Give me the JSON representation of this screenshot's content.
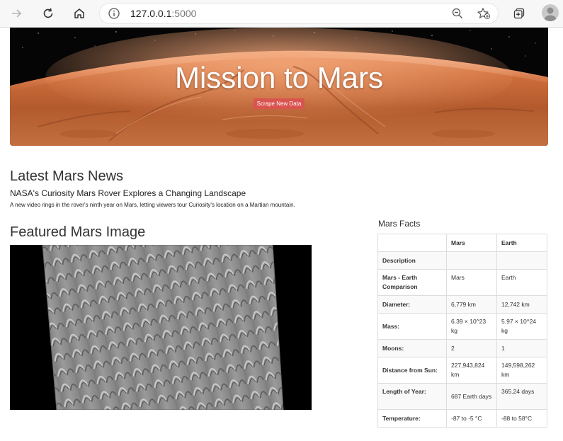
{
  "browser": {
    "url_host": "127.0.0.1",
    "url_port": ":5000"
  },
  "hero": {
    "title": "Mission to Mars",
    "scrape_button": "Scrape New Data"
  },
  "news": {
    "heading": "Latest Mars News",
    "title": "NASA's Curiosity Mars Rover Explores a Changing Landscape",
    "paragraph": "A new video rings in the rover's ninth year on Mars, letting viewers tour Curiosity's location on a Martian mountain."
  },
  "featured": {
    "heading": "Featured Mars Image"
  },
  "facts": {
    "heading": "Mars Facts",
    "columns": [
      "",
      "Mars",
      "Earth"
    ],
    "rows": [
      {
        "label": "Description",
        "mars": "",
        "earth": ""
      },
      {
        "label": "Mars - Earth Comparison",
        "mars": "Mars",
        "earth": "Earth"
      },
      {
        "label": "Diameter:",
        "mars": "6,779 km",
        "earth": "12,742 km"
      },
      {
        "label": "Mass:",
        "mars": "6.39 × 10^23 kg",
        "earth": "5.97 × 10^24 kg"
      },
      {
        "label": "Moons:",
        "mars": "2",
        "earth": "1"
      },
      {
        "label": "Distance from Sun:",
        "mars": "227,943,824 km",
        "earth": "149,598,262 km"
      },
      {
        "label": "Length of Year:",
        "mars": "687 Earth days",
        "earth": "365.24 days"
      },
      {
        "label": "Temperature:",
        "mars": "-87 to -5 °C",
        "earth": "-88 to 58°C"
      }
    ]
  },
  "colors": {
    "scrape_button": "#d9534f",
    "chrome_bg": "#f7f7f7"
  }
}
